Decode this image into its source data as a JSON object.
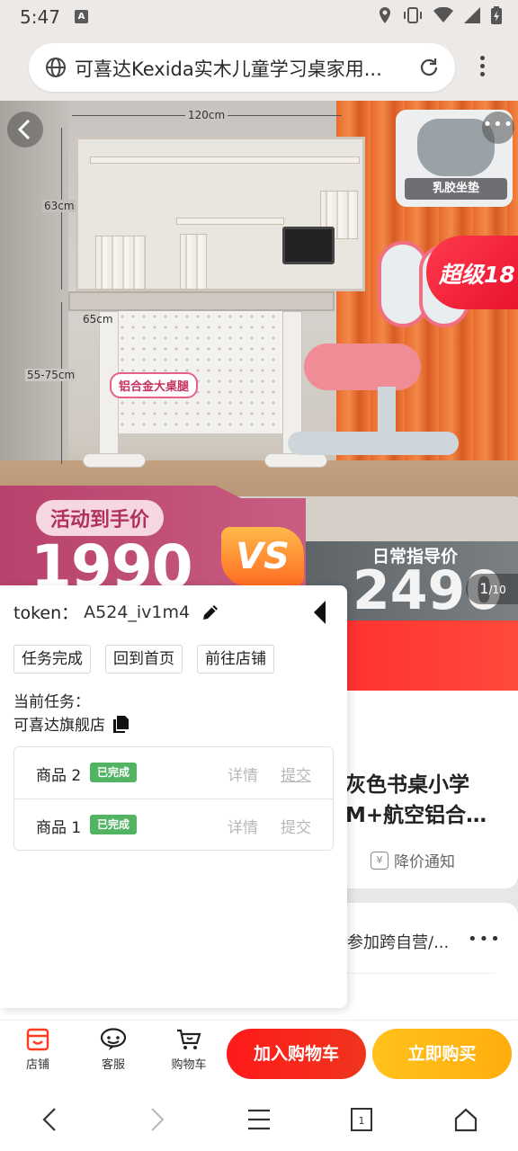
{
  "status_bar": {
    "time": "5:47",
    "notification_badge": "A"
  },
  "browser": {
    "url_text": "可喜达Kexida实木儿童学习桌家用..."
  },
  "hero": {
    "dimensions": {
      "width": "120cm",
      "hutch_height": "63cm",
      "depth": "65cm",
      "desk_height": "55-75cm"
    },
    "alloy_tag": "铝合金大桌腿",
    "cushion_label": "乳胶坐垫",
    "super_tag": "超级18",
    "promo_label": "活动到手价",
    "promo_price": "1990",
    "vs_label": "VS",
    "daily_label": "日常指导价",
    "daily_price": "2490",
    "image_index": "1",
    "image_total": "/10"
  },
  "product_info": {
    "title": "灰色书桌小学M+航空铝合…",
    "price_notify": "降价通知",
    "service_text": "参加跨自营/..."
  },
  "panel": {
    "token_label": "token：",
    "token_value": "A524_iv1m4",
    "buttons": {
      "task_done": "任务完成",
      "back_home": "回到首页",
      "go_store": "前往店铺"
    },
    "current_task_label": "当前任务：",
    "current_task_name": "可喜达旗舰店",
    "tasks": [
      {
        "name": "商品 2",
        "status": "已完成",
        "detail": "详情",
        "submit": "提交"
      },
      {
        "name": "商品 1",
        "status": "已完成",
        "detail": "详情",
        "submit": "提交"
      }
    ]
  },
  "action_bar": {
    "store": "店铺",
    "service": "客服",
    "cart": "购物车",
    "add_to_cart": "加入购物车",
    "buy_now": "立即购买"
  },
  "colors": {
    "accent_red": "#ff1a1a",
    "accent_yellow": "#ffc21a",
    "badge_green": "#52b463"
  }
}
